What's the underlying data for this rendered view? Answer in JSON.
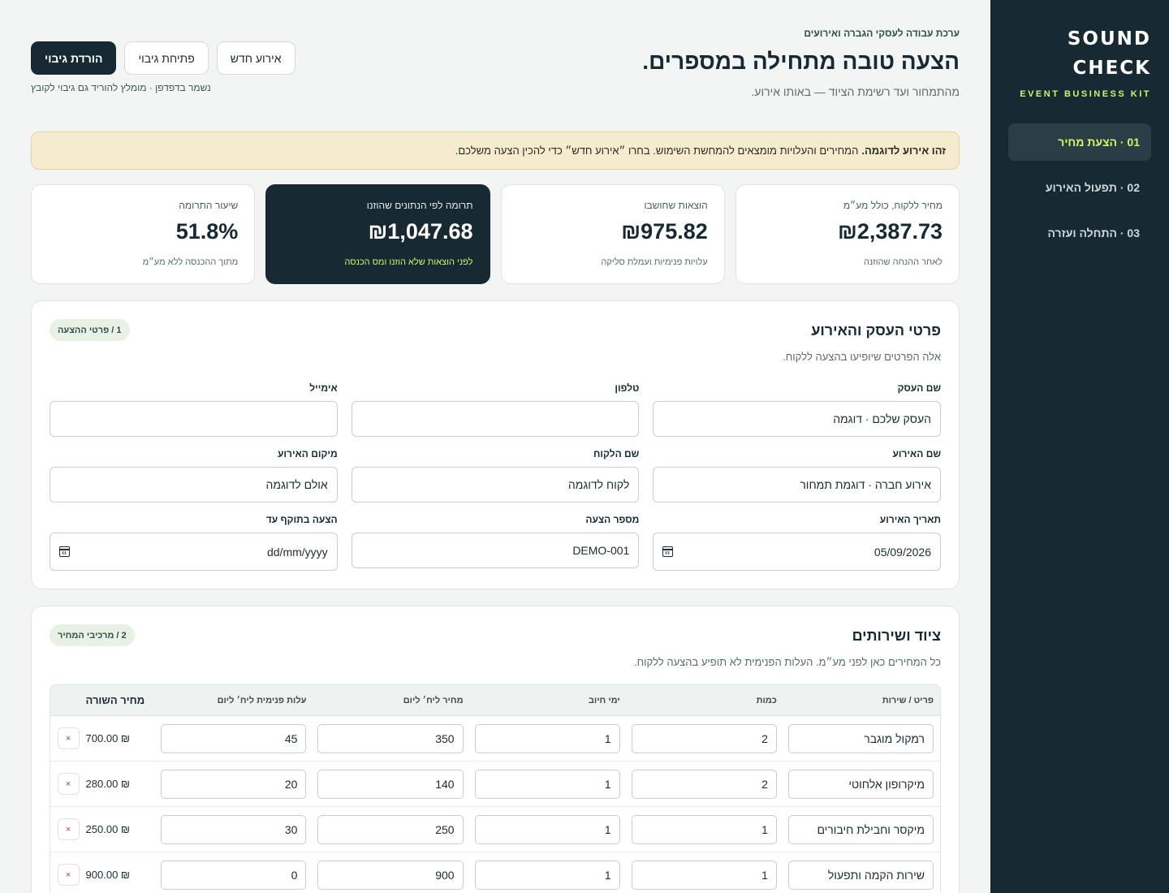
{
  "sidebar": {
    "brand_line1": "SOUND",
    "brand_line2": "CHECK",
    "brand_sub": "EVENT BUSINESS KIT",
    "nav": [
      {
        "label": "01 · הצעת מחיר"
      },
      {
        "label": "02 · תפעול האירוע"
      },
      {
        "label": "03 · התחלה ועזרה"
      }
    ]
  },
  "header": {
    "eyebrow": "ערכת עבודה לעסקי הגברה ואירועים",
    "title": "הצעה טובה מתחילה במספרים.",
    "subtitle": "מהתמחור ועד רשימת הציוד — באותו אירוע.",
    "download_backup": "הורדת גיבוי",
    "open_backup": "פתיחת גיבוי",
    "new_event": "אירוע חדש",
    "note": "נשמר בדפדפן · מומלץ להוריד גם גיבוי לקובץ"
  },
  "notice": {
    "bold": "זהו אירוע לדוגמה.",
    "text": "המחירים והעלויות מומצאים להמחשת השימוש. בחרו ״אירוע חדש״ כדי להכין הצעה משלכם."
  },
  "kpis": [
    {
      "label": "מחיר ללקוח, כולל מע״מ",
      "value": "₪2,387.73",
      "note": "לאחר ההנחה שהוזנה"
    },
    {
      "label": "הוצאות שחושבו",
      "value": "₪975.82",
      "note": "עלויות פנימיות ועמלת סליקה"
    },
    {
      "label": "תרומה לפי הנתונים שהוזנו",
      "value": "₪1,047.68",
      "note": "לפני הוצאות שלא הוזנו ומס הכנסה"
    },
    {
      "label": "שיעור התרומה",
      "value": "51.8%",
      "note": "מתוך ההכנסה ללא מע״מ"
    }
  ],
  "details": {
    "title": "פרטי העסק והאירוע",
    "subtitle": "אלה הפרטים שיופיעו בהצעה ללקוח.",
    "chip": "1 / פרטי ההצעה",
    "fields": [
      {
        "label": "שם העסק",
        "value": "העסק שלכם · דוגמה"
      },
      {
        "label": "טלפון",
        "value": ""
      },
      {
        "label": "אימייל",
        "value": ""
      },
      {
        "label": "שם האירוע",
        "value": "אירוע חברה · דוגמת תמחור"
      },
      {
        "label": "שם הלקוח",
        "value": "לקוח לדוגמה"
      },
      {
        "label": "מיקום האירוע",
        "value": "אולם לדוגמה"
      },
      {
        "label": "תאריך האירוע",
        "value": "05/09/2026"
      },
      {
        "label": "מספר הצעה",
        "value": "DEMO-001"
      },
      {
        "label": "הצעה בתוקף עד",
        "value": "dd/mm/yyyy"
      }
    ]
  },
  "equipment": {
    "title": "ציוד ושירותים",
    "subtitle": "כל המחירים כאן לפני מע״מ. העלות הפנימית לא תופיע בהצעה ללקוח.",
    "chip": "2 / מרכיבי המחיר",
    "columns": [
      "פריט / שירות",
      "כמות",
      "ימי חיוב",
      "מחיר ליח׳ ליום",
      "עלות פנימית ליח׳ ליום",
      "מחיר השורה"
    ],
    "rows": [
      {
        "item": "רמקול מוגבר",
        "qty": "2",
        "days": "1",
        "price": "350",
        "cost": "45",
        "total": "₪ 700.00"
      },
      {
        "item": "מיקרופון אלחוטי",
        "qty": "2",
        "days": "1",
        "price": "140",
        "cost": "20",
        "total": "₪ 280.00"
      },
      {
        "item": "מיקסר וחבילת חיבורים",
        "qty": "1",
        "days": "1",
        "price": "250",
        "cost": "30",
        "total": "₪ 250.00"
      },
      {
        "item": "שירות הקמה ותפעול",
        "qty": "1",
        "days": "1",
        "price": "900",
        "cost": "0",
        "total": "₪ 900.00"
      }
    ],
    "delete_glyph": "×"
  }
}
